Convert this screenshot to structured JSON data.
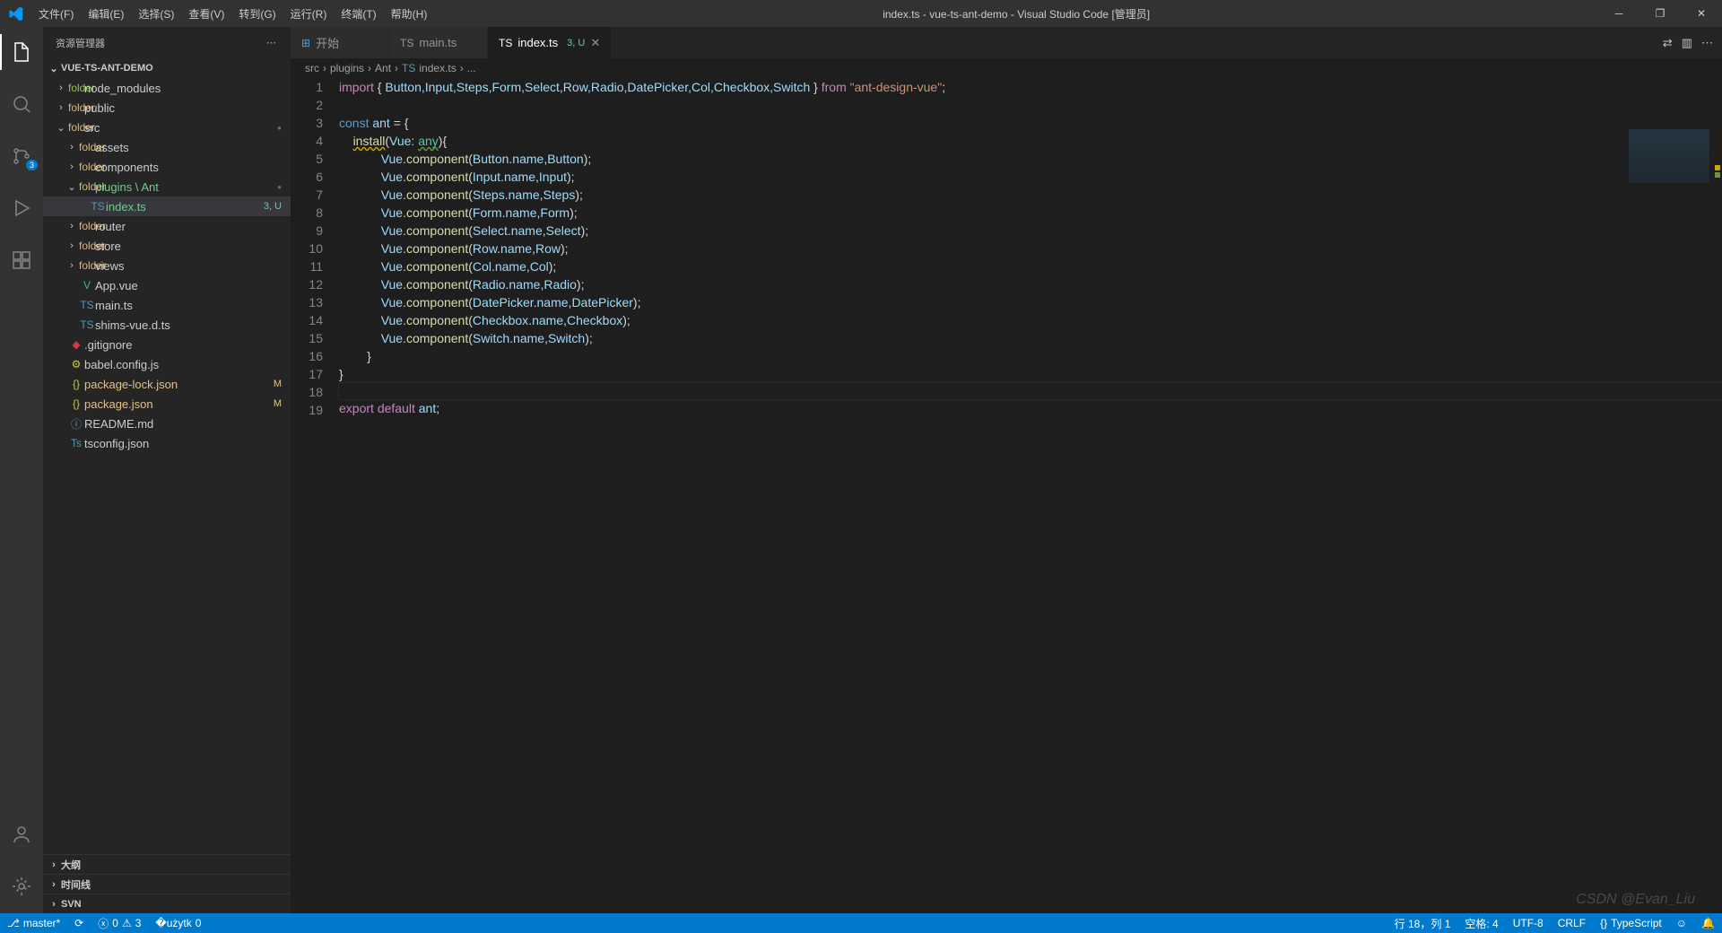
{
  "window": {
    "title": "index.ts - vue-ts-ant-demo - Visual Studio Code [管理员]"
  },
  "menu": [
    "文件(F)",
    "编辑(E)",
    "选择(S)",
    "查看(V)",
    "转到(G)",
    "运行(R)",
    "终端(T)",
    "帮助(H)"
  ],
  "activitybar": {
    "scm_badge": "3"
  },
  "sidebar": {
    "title": "资源管理器",
    "project": "VUE-TS-ANT-DEMO",
    "tree": [
      {
        "indent": 1,
        "chev": "›",
        "ico": "folder",
        "cls": "green",
        "label": "node_modules"
      },
      {
        "indent": 1,
        "chev": "›",
        "ico": "folder",
        "cls": "folder",
        "label": "public"
      },
      {
        "indent": 1,
        "chev": "⌄",
        "ico": "folder",
        "cls": "folder",
        "label": "src",
        "dot": true
      },
      {
        "indent": 2,
        "chev": "›",
        "ico": "folder",
        "cls": "folder",
        "label": "assets"
      },
      {
        "indent": 2,
        "chev": "›",
        "ico": "folder",
        "cls": "folder",
        "label": "components"
      },
      {
        "indent": 2,
        "chev": "⌄",
        "ico": "folder",
        "cls": "folder",
        "label": "plugins \\ Ant",
        "dot": true,
        "git": "u"
      },
      {
        "indent": 3,
        "chev": "",
        "ico": "TS",
        "cls": "ts",
        "label": "index.ts",
        "selected": true,
        "badge": "3, U",
        "git": "u"
      },
      {
        "indent": 2,
        "chev": "›",
        "ico": "folder",
        "cls": "folder",
        "label": "router"
      },
      {
        "indent": 2,
        "chev": "›",
        "ico": "folder",
        "cls": "folder",
        "label": "store"
      },
      {
        "indent": 2,
        "chev": "›",
        "ico": "folder",
        "cls": "folder",
        "label": "views"
      },
      {
        "indent": 2,
        "chev": "",
        "ico": "V",
        "cls": "vue",
        "label": "App.vue"
      },
      {
        "indent": 2,
        "chev": "",
        "ico": "TS",
        "cls": "ts",
        "label": "main.ts"
      },
      {
        "indent": 2,
        "chev": "",
        "ico": "TS",
        "cls": "ts",
        "label": "shims-vue.d.ts"
      },
      {
        "indent": 1,
        "chev": "",
        "ico": "◆",
        "cls": "red",
        "label": ".gitignore"
      },
      {
        "indent": 1,
        "chev": "",
        "ico": "⚙",
        "cls": "js",
        "label": "babel.config.js"
      },
      {
        "indent": 1,
        "chev": "",
        "ico": "{}",
        "cls": "json",
        "label": "package-lock.json",
        "badge": "M",
        "git": "m"
      },
      {
        "indent": 1,
        "chev": "",
        "ico": "{}",
        "cls": "json",
        "label": "package.json",
        "badge": "M",
        "git": "m"
      },
      {
        "indent": 1,
        "chev": "",
        "ico": "ⓘ",
        "cls": "md",
        "label": "README.md"
      },
      {
        "indent": 1,
        "chev": "",
        "ico": "Ts",
        "cls": "ts",
        "label": "tsconfig.json"
      }
    ],
    "outline": "大纲",
    "timeline": "时间线",
    "svn": "SVN"
  },
  "tabs": [
    {
      "ico": "⊞",
      "cls": "b",
      "label": "开始",
      "active": false
    },
    {
      "ico": "TS",
      "cls": "ts",
      "label": "main.ts",
      "active": false
    },
    {
      "ico": "TS",
      "cls": "ts",
      "label": "index.ts",
      "badge": "3, U",
      "active": true,
      "close": true
    }
  ],
  "breadcrumb": [
    "src",
    "plugins",
    "Ant",
    "index.ts",
    "..."
  ],
  "code": {
    "import_kw": "import",
    "from_kw": "from",
    "const_kw": "const",
    "default_kw": "default",
    "import_names": "Button,Input,Steps,Form,Select,Row,Radio,DatePicker,Col,Checkbox,Switch",
    "module": "\"ant-design-vue\"",
    "ant": "ant",
    "eq": "= {",
    "install": "install",
    "vue_param": "Vue",
    "any": "any",
    "lines": [
      {
        "obj": "Button"
      },
      {
        "obj": "Input"
      },
      {
        "obj": "Steps"
      },
      {
        "obj": "Form"
      },
      {
        "obj": "Select"
      },
      {
        "obj": "Row"
      },
      {
        "obj": "Col"
      },
      {
        "obj": "Radio"
      },
      {
        "obj": "DatePicker"
      },
      {
        "obj": "Checkbox"
      },
      {
        "obj": "Switch"
      }
    ],
    "component": "component",
    "name": "name",
    "Vue": "Vue",
    "export_kw": "export"
  },
  "status": {
    "branch": "master*",
    "errors": "0",
    "warnings": "3",
    "port": "0",
    "ln_col": "行 18，列 1",
    "spaces": "空格: 4",
    "encoding": "UTF-8",
    "eol": "CRLF",
    "lang": "TypeScript",
    "feedback": "☺",
    "bell": "🔔"
  },
  "watermark": "CSDN @Evan_Liu"
}
